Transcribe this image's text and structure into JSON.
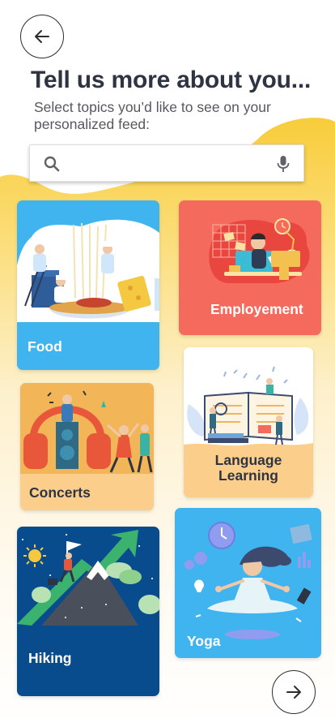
{
  "header": {
    "title": "Tell us more about you...",
    "subtitle": "Select topics you’d like to see on your personalized feed:"
  },
  "search": {
    "value": "",
    "placeholder": "",
    "search_icon": "search-icon",
    "mic_icon": "microphone-icon"
  },
  "topics": [
    {
      "label": "Food",
      "color": "#3fb4ef",
      "illustration": "chefs-cooking-pasta"
    },
    {
      "label": "Employement",
      "color": "#f46a5c",
      "illustration": "man-working-at-desk"
    },
    {
      "label": "Concerts",
      "color": "#fcce8c",
      "illustration": "people-dancing-music"
    },
    {
      "label": "Language Learning",
      "color": "#fcce8c",
      "illustration": "people-with-open-book"
    },
    {
      "label": "Hiking",
      "color": "#094c8e",
      "illustration": "climber-with-flag-on-mountain"
    },
    {
      "label": "Yoga",
      "color": "#3fb4ef",
      "illustration": "woman-meditating"
    }
  ],
  "navigation": {
    "back_icon": "arrow-left-icon",
    "next_icon": "arrow-right-icon"
  },
  "colors": {
    "background_accent": "#f8cd3c",
    "title": "#2f3443"
  }
}
